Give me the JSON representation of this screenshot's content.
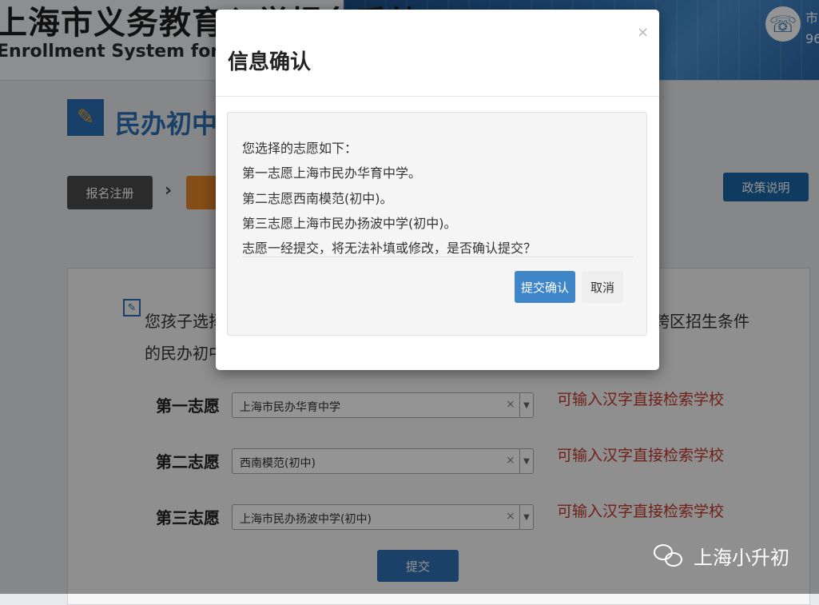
{
  "header": {
    "title": "上海市义务教育入学报名系统",
    "subtitle": "Enrollment System for Compulsory Education",
    "phone_line_1": "市",
    "phone_line_2": "96"
  },
  "section": {
    "title": "民办初中申请"
  },
  "steps": {
    "register": "报名注册",
    "arrow": "›",
    "policy": "政策说明"
  },
  "form": {
    "intro_line_1": "您孩子选择的",
    "intro_line_2": "的民办初中",
    "intro_right": "跨区招生条件",
    "choices": [
      {
        "label": "第一志愿",
        "value": "上海市民办华育中学",
        "hint": "可输入汉字直接检索学校"
      },
      {
        "label": "第二志愿",
        "value": "西南模范(初中)",
        "hint": "可输入汉字直接检索学校"
      },
      {
        "label": "第三志愿",
        "value": "上海市民办扬波中学(初中)",
        "hint": "可输入汉字直接检索学校"
      }
    ],
    "clear_glyph": "×",
    "submit": "提交"
  },
  "modal": {
    "title": "信息确认",
    "close": "×",
    "lines": [
      "您选择的志愿如下：",
      "第一志愿上海市民办华育中学。",
      "第二志愿西南模范(初中)。",
      "第三志愿上海市民办扬波中学(初中)。",
      "志愿一经提交，将无法补填或修改，是否确认提交？"
    ],
    "confirm": "提交确认",
    "cancel": "取消"
  },
  "watermark": {
    "text": "上海小升初"
  }
}
